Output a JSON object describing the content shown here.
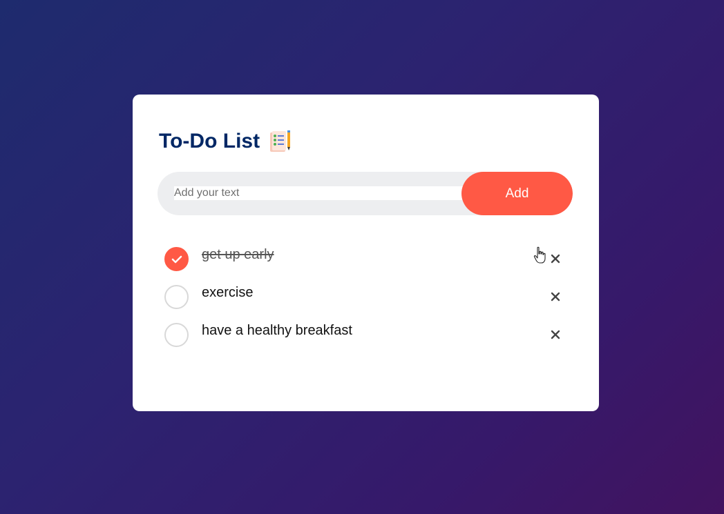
{
  "app": {
    "title": "To-Do List"
  },
  "input": {
    "placeholder": "Add your text",
    "value": ""
  },
  "add_button": {
    "label": "Add"
  },
  "tasks": [
    {
      "text": "get up early",
      "checked": true
    },
    {
      "text": "exercise",
      "checked": false
    },
    {
      "text": "have a healthy breakfast",
      "checked": false
    }
  ],
  "icons": {
    "title_icon": "checklist-notepad-icon",
    "check": "checkmark-icon",
    "delete": "close-icon",
    "cursor": "hand-pointer-cursor-icon"
  },
  "colors": {
    "accent": "#ff5945",
    "title": "#002765",
    "input_bg": "#edeef0",
    "card_bg": "#ffffff",
    "circle_border": "#d8d8d8"
  }
}
